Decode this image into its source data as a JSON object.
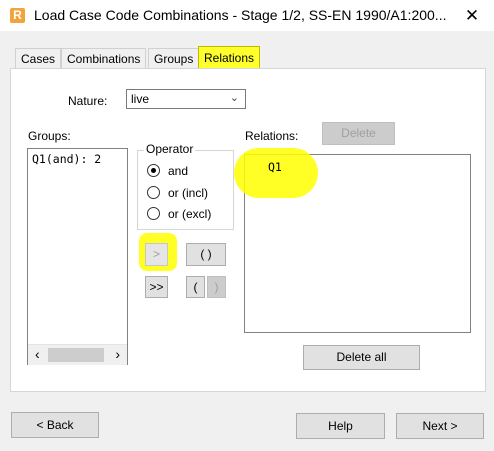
{
  "window": {
    "title": "Load Case Code Combinations - Stage 1/2, SS-EN 1990/A1:200...",
    "app_icon": "R",
    "close": "✕"
  },
  "tabs": [
    {
      "label": "Cases",
      "active": false
    },
    {
      "label": "Combinations",
      "active": false
    },
    {
      "label": "Groups",
      "active": false
    },
    {
      "label": "Relations",
      "active": true
    }
  ],
  "nature": {
    "label": "Nature:",
    "value": "live"
  },
  "groups": {
    "label": "Groups:",
    "items": [
      "Q1(and): 2"
    ]
  },
  "operator": {
    "title": "Operator",
    "options": [
      {
        "label": "and",
        "checked": true
      },
      {
        "label": "or (incl)",
        "checked": false
      },
      {
        "label": "or (excl)",
        "checked": false
      }
    ]
  },
  "transfer_buttons": {
    "add": ">",
    "add_all": ">>",
    "parens": "( )",
    "open_paren": "(",
    "close_paren": ")"
  },
  "relations": {
    "label": "Relations:",
    "delete": "Delete",
    "items": [
      "Q1"
    ],
    "delete_all": "Delete all"
  },
  "footer": {
    "back": "< Back",
    "help": "Help",
    "next": "Next >"
  },
  "colors": {
    "highlight": "#ffff00",
    "active_tab": "#ffff2e",
    "app_icon": "#f2a33a"
  }
}
